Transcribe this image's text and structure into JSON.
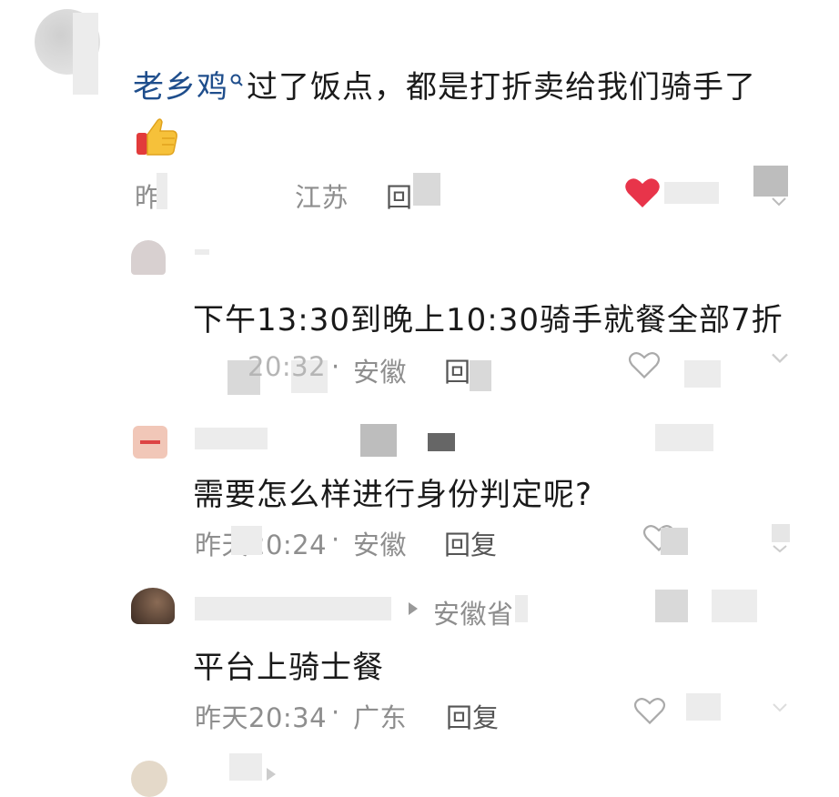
{
  "thread": {
    "top_comment": {
      "username": "老乡鸡",
      "search_icon": "search-icon",
      "text": "过了饭点，都是打折卖给我们骑手了",
      "emoji": "👍",
      "time": "昨",
      "location": "江苏",
      "reply_label": "回",
      "liked": true,
      "accent_color": "#e8344a",
      "username_color": "#1f4e8c"
    },
    "replies": [
      {
        "text": "下午13:30到晚上10:30骑手就餐全部7折",
        "time": "20:32",
        "location": "安徽",
        "reply_label": "回"
      },
      {
        "text": "需要怎么样进行身份判定呢?",
        "time": "昨天20:24",
        "location": "安徽",
        "reply_label": "回复"
      },
      {
        "reply_to": "安徽省",
        "text": "平台上骑士餐",
        "time": "昨天20:34",
        "location": "广东",
        "reply_label": "回复"
      }
    ],
    "separator": "·"
  }
}
